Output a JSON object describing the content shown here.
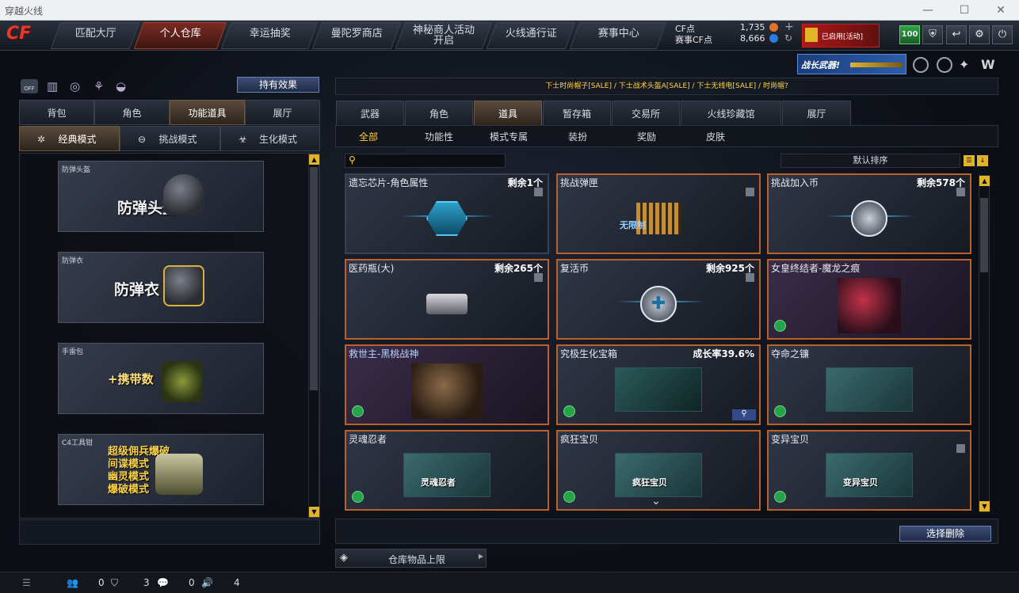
{
  "window": {
    "title": "穿越火线"
  },
  "nav": {
    "tabs": [
      "匹配大厅",
      "个人仓库",
      "幸运抽奖",
      "曼陀罗商店",
      "神秘商人活动开启",
      "火线通行证",
      "赛事中心"
    ],
    "cf_points_label": "CF点",
    "cf_points_value": "1,735",
    "event_points_label": "赛事CF点",
    "event_points_value": "8,666",
    "level_badge": "100",
    "avatar_caption": "已启用[活动]"
  },
  "banner": {
    "text": "战长武器!"
  },
  "left": {
    "effects_button": "持有效果",
    "effects_toggle": "OFF",
    "tabs": [
      "背包",
      "角色",
      "功能道具",
      "展厅"
    ],
    "active_tab": 2,
    "modes": [
      "经典模式",
      "挑战模式",
      "生化模式"
    ],
    "equipment": [
      {
        "label": "防弹头盔",
        "title": "防弹头盔"
      },
      {
        "label": "防弹衣",
        "title": "防弹衣"
      },
      {
        "label": "手雷包",
        "title": "+携带数"
      },
      {
        "label": "C4工具钳",
        "lines": [
          "超级佣兵爆破",
          "间谍模式",
          "幽灵模式",
          "爆破模式"
        ]
      }
    ]
  },
  "right": {
    "ticker": "下士时尚帽子[SALE] / 下士战术头盔A[SALE] / 下士无线电[SALE] / 时尚帽?",
    "tabs": [
      "武器",
      "角色",
      "道具",
      "暂存箱",
      "交易所",
      "火线珍藏馆",
      "展厅"
    ],
    "active_tab": 2,
    "subtabs": [
      "全部",
      "功能性",
      "模式专属",
      "装扮",
      "奖励",
      "皮肤"
    ],
    "active_subtab": 0,
    "search_placeholder": "",
    "sort_label": "默认排序",
    "items": [
      {
        "name": "遗忘芯片-角色属性",
        "count": "剩余1个",
        "art": "hex"
      },
      {
        "name": "挑战弹匣",
        "count": "",
        "art": "ammo",
        "art_text": "无限制"
      },
      {
        "name": "挑战加入币",
        "count": "剩余578个",
        "art": "coin"
      },
      {
        "name": "医药瓶(大)",
        "count": "剩余265个",
        "art": "gun"
      },
      {
        "name": "复活币",
        "count": "剩余925个",
        "art": "coin"
      },
      {
        "name": "女皇终结者-魔龙之痕",
        "count": "",
        "art": "char"
      },
      {
        "name": "救世主-黑桃战神",
        "count": "",
        "art": "char"
      },
      {
        "name": "究极生化宝箱",
        "count": "成长率39.6%",
        "art": "photo"
      },
      {
        "name": "夺命之镰",
        "count": "",
        "art": "photo"
      },
      {
        "name": "灵魂忍者",
        "count": "",
        "art": "photo",
        "art_text": "灵魂忍者"
      },
      {
        "name": "疯狂宝贝",
        "count": "",
        "art": "photo",
        "art_text": "疯狂宝贝"
      },
      {
        "name": "变异宝贝",
        "count": "",
        "art": "photo",
        "art_text": "变异宝贝"
      }
    ],
    "delete_button": "选择删除",
    "capacity_button": "仓库物品上限"
  },
  "statusbar": {
    "friends": "0",
    "shield": "3",
    "chat": "0",
    "volume": "4"
  }
}
